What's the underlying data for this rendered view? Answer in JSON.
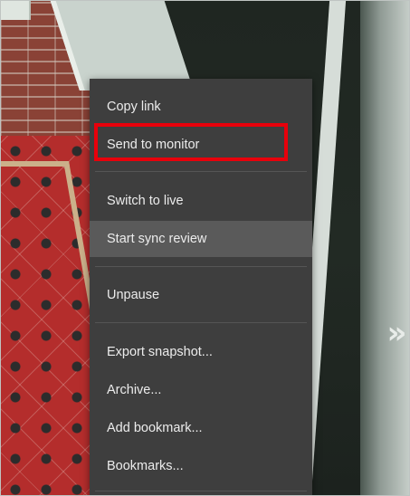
{
  "menu": {
    "items": [
      {
        "label": "Copy link"
      },
      {
        "label": "Send to monitor"
      },
      {
        "label": "Switch to live"
      },
      {
        "label": "Start sync review"
      },
      {
        "label": "Unpause"
      },
      {
        "label": "Export snapshot..."
      },
      {
        "label": "Archive..."
      },
      {
        "label": "Add bookmark..."
      },
      {
        "label": "Bookmarks..."
      }
    ],
    "hovered_item": "Start sync review",
    "highlighted_item": "Send to monitor"
  },
  "navigation": {
    "next_icon": "double-chevron-right-icon",
    "next_glyph": "»"
  },
  "colors": {
    "menu_background": "#3e3e3e",
    "menu_hover": "#5a5a5a",
    "menu_text": "#ececec",
    "highlight_box": "#e8000b"
  }
}
